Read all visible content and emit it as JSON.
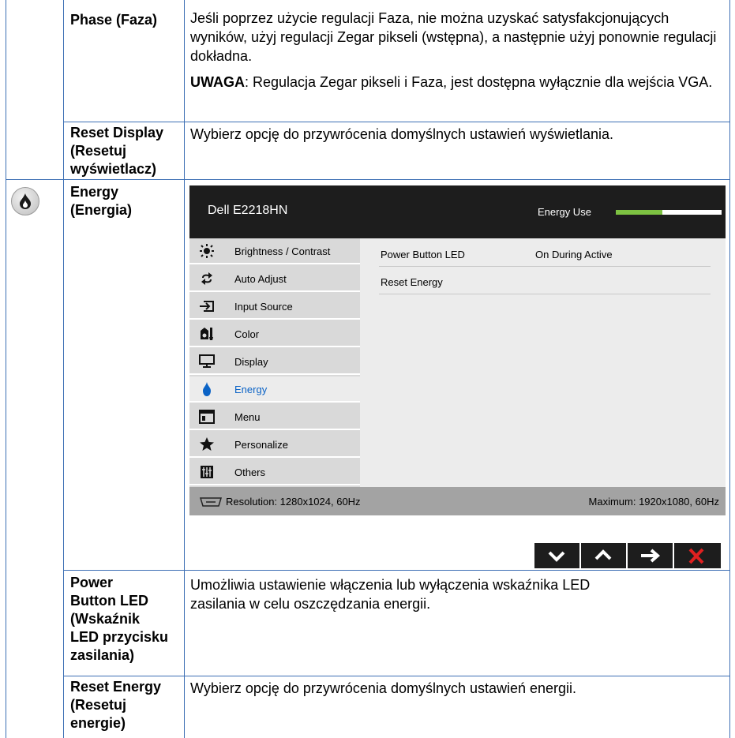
{
  "rows": [
    {
      "term": "Phase (Faza)",
      "desc": "Jeśli poprzez użycie regulacji Faza, nie można uzyskać satysfakcjonujących wyników, użyj regulacji Zegar pikseli (wstępna), a następnie użyj ponownie regulacji dokładna.",
      "note_label": "UWAGA",
      "note_text": ": Regulacja Zegar pikseli i Faza, jest dostępna wyłącznie dla wejścia VGA."
    },
    {
      "term_lines": [
        "Reset Display",
        "(Resetuj",
        "wyświetlacz)"
      ],
      "desc": "Wybierz opcję do przywrócenia domyślnych ustawień wyświetlania."
    },
    {
      "term_lines": [
        "Energy",
        "(Energia)"
      ],
      "icon": "energy-flame-icon"
    },
    {
      "term_lines": [
        "Power",
        "Button LED",
        "(Wskaźnik",
        "LED przycisku",
        "zasilania)"
      ],
      "desc_lines": [
        "Umożliwia ustawienie włączenia lub wyłączenia wskaźnika LED",
        "zasilania w celu oszczędzania energii."
      ]
    },
    {
      "term_lines": [
        "Reset Energy",
        "(Resetuj",
        "energie)"
      ],
      "desc": "Wybierz opcję do przywrócenia domyślnych ustawień energii."
    }
  ],
  "osd": {
    "title": "Dell E2218HN",
    "energy_use_label": "Energy Use",
    "energy_use_level": 0.44,
    "colors": {
      "accent_green": "#7dc242",
      "active_blue": "#0b63c6",
      "header_bg": "#1d1d1d",
      "close_red": "#e02020"
    },
    "menu": [
      {
        "label": "Brightness / Contrast",
        "icon": "sun-icon"
      },
      {
        "label": "Auto Adjust",
        "icon": "auto-adjust-icon"
      },
      {
        "label": "Input Source",
        "icon": "input-source-icon"
      },
      {
        "label": "Color",
        "icon": "color-icon"
      },
      {
        "label": "Display",
        "icon": "monitor-icon"
      },
      {
        "label": "Energy",
        "icon": "energy-flame-icon",
        "active": true
      },
      {
        "label": "Menu",
        "icon": "menu-icon"
      },
      {
        "label": "Personalize",
        "icon": "star-icon"
      },
      {
        "label": "Others",
        "icon": "others-icon"
      }
    ],
    "settings": [
      {
        "label": "Power Button LED",
        "value": "On During Active"
      },
      {
        "label": "Reset Energy",
        "value": ""
      }
    ],
    "resolution": "Resolution: 1280x1024, 60Hz",
    "maximum": "Maximum: 1920x1080, 60Hz",
    "buttons": [
      "chevron-down-icon",
      "chevron-up-icon",
      "arrow-right-icon",
      "close-icon"
    ]
  }
}
